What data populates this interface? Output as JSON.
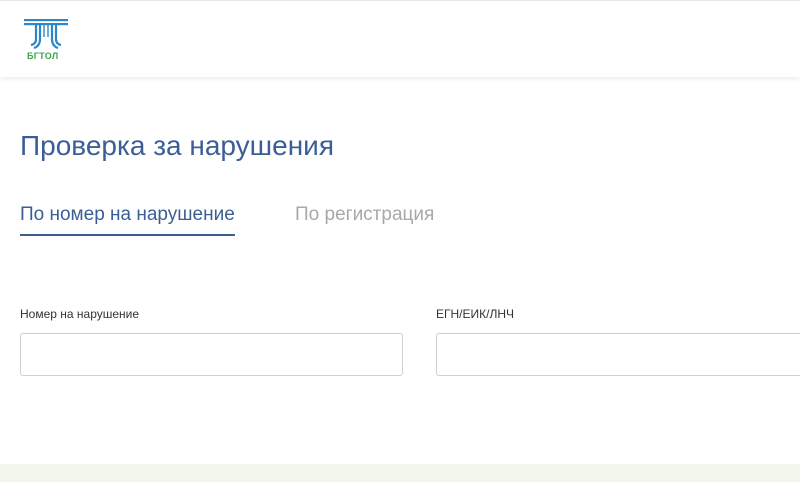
{
  "header": {
    "logo_text": "БГТОЛ"
  },
  "main": {
    "title": "Проверка за нарушения",
    "tabs": [
      {
        "label": "По номер на нарушение",
        "active": true
      },
      {
        "label": "По регистрация",
        "active": false
      }
    ],
    "fields": [
      {
        "label": "Номер на нарушение",
        "value": "",
        "placeholder": ""
      },
      {
        "label": "ЕГН/ЕИК/ЛНЧ",
        "value": "",
        "placeholder": ""
      }
    ]
  },
  "colors": {
    "title": "#3b5f95",
    "tab_inactive": "#a8a8a8",
    "logo_blue": "#2e86c8",
    "logo_green": "#3aa64a",
    "footer_band": "#f1f7ea"
  },
  "icons": {
    "logo": "bgtol-road-logo-icon"
  }
}
